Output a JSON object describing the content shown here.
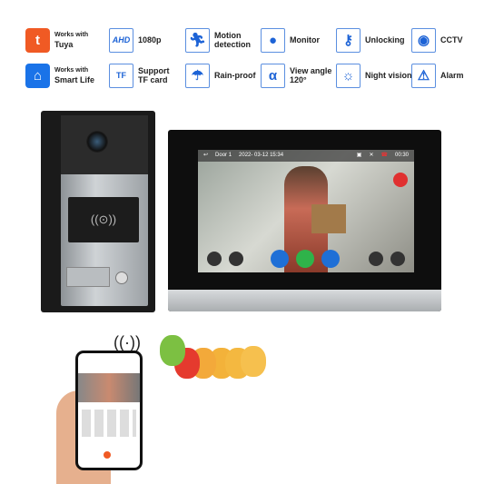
{
  "features": [
    {
      "icon": "tuya-logo-icon",
      "small": "Works with",
      "label": "Tuya",
      "color": "#f05a24"
    },
    {
      "icon": "ahd-icon",
      "icon_text": "AHD",
      "label": "1080p"
    },
    {
      "icon": "running-man-icon",
      "label": "Motion detection"
    },
    {
      "icon": "person-icon",
      "label": "Monitor"
    },
    {
      "icon": "key-icon",
      "label": "Unlocking"
    },
    {
      "icon": "cctv-camera-icon",
      "label": "CCTV"
    },
    {
      "icon": "smart-life-logo-icon",
      "small": "Works with",
      "label": "Smart Life",
      "color": "#1a73e8"
    },
    {
      "icon": "tf-card-icon",
      "icon_text": "TF",
      "label": "Support TF card"
    },
    {
      "icon": "umbrella-rain-icon",
      "label": "Rain-proof"
    },
    {
      "icon": "view-angle-icon",
      "label": "View angle 120°"
    },
    {
      "icon": "sun-icon",
      "label": "Night vision"
    },
    {
      "icon": "alarm-light-icon",
      "label": "Alarm"
    }
  ],
  "monitor": {
    "door": "Door 1",
    "datetime": "2022- 03-12 15:34",
    "timer": "00:30"
  }
}
